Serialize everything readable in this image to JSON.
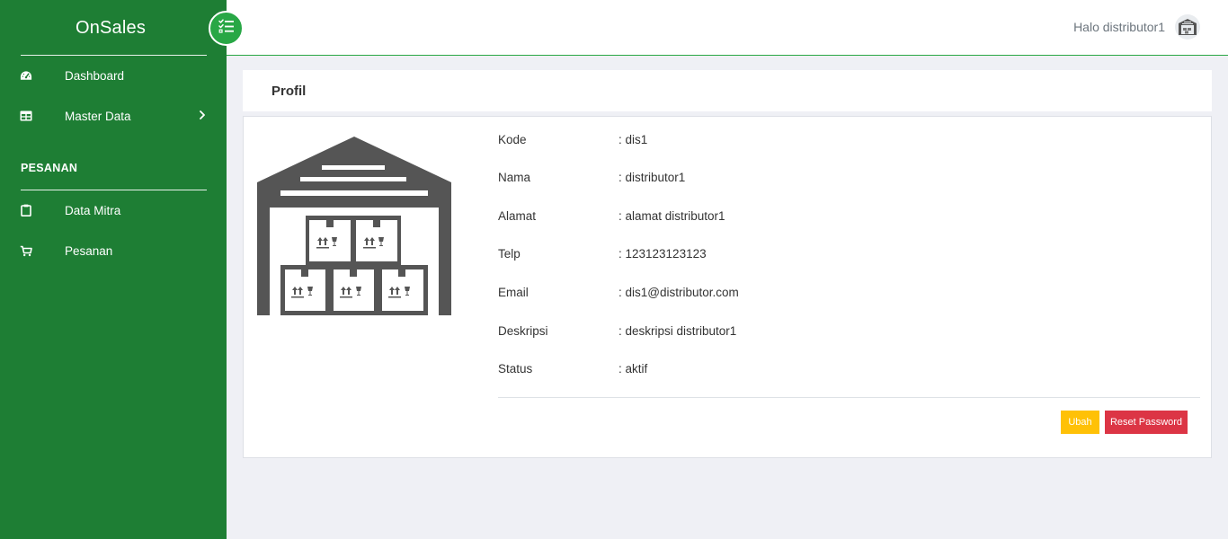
{
  "brand": {
    "name": "OnSales"
  },
  "sidebar": {
    "items": [
      {
        "label": "Dashboard",
        "icon": "dashboard-icon"
      },
      {
        "label": "Master Data",
        "icon": "table-icon",
        "has_submenu": true
      }
    ],
    "section_label": "PESANAN",
    "section_items": [
      {
        "label": "Data Mitra",
        "icon": "clipboard-icon"
      },
      {
        "label": "Pesanan",
        "icon": "cart-icon"
      }
    ]
  },
  "topbar": {
    "greeting": "Halo distributor1",
    "avatar_icon": "warehouse-avatar-icon"
  },
  "page": {
    "title": "Profil"
  },
  "profile": {
    "image_icon": "warehouse-icon",
    "fields": [
      {
        "label": "Kode",
        "value": ": dis1"
      },
      {
        "label": "Nama",
        "value": ": distributor1"
      },
      {
        "label": "Alamat",
        "value": ": alamat distributor1"
      },
      {
        "label": "Telp",
        "value": ": 123123123123"
      },
      {
        "label": "Email",
        "value": ": dis1@distributor.com"
      },
      {
        "label": "Deskripsi",
        "value": ": deskripsi distributor1"
      },
      {
        "label": "Status",
        "value": ": aktif"
      }
    ]
  },
  "actions": {
    "edit_label": "Ubah",
    "reset_label": "Reset Password"
  },
  "colors": {
    "sidebar": "#1e7e34",
    "accent": "#28a745",
    "warning": "#ffc107",
    "danger": "#dc3545",
    "background": "#eff0f5"
  }
}
